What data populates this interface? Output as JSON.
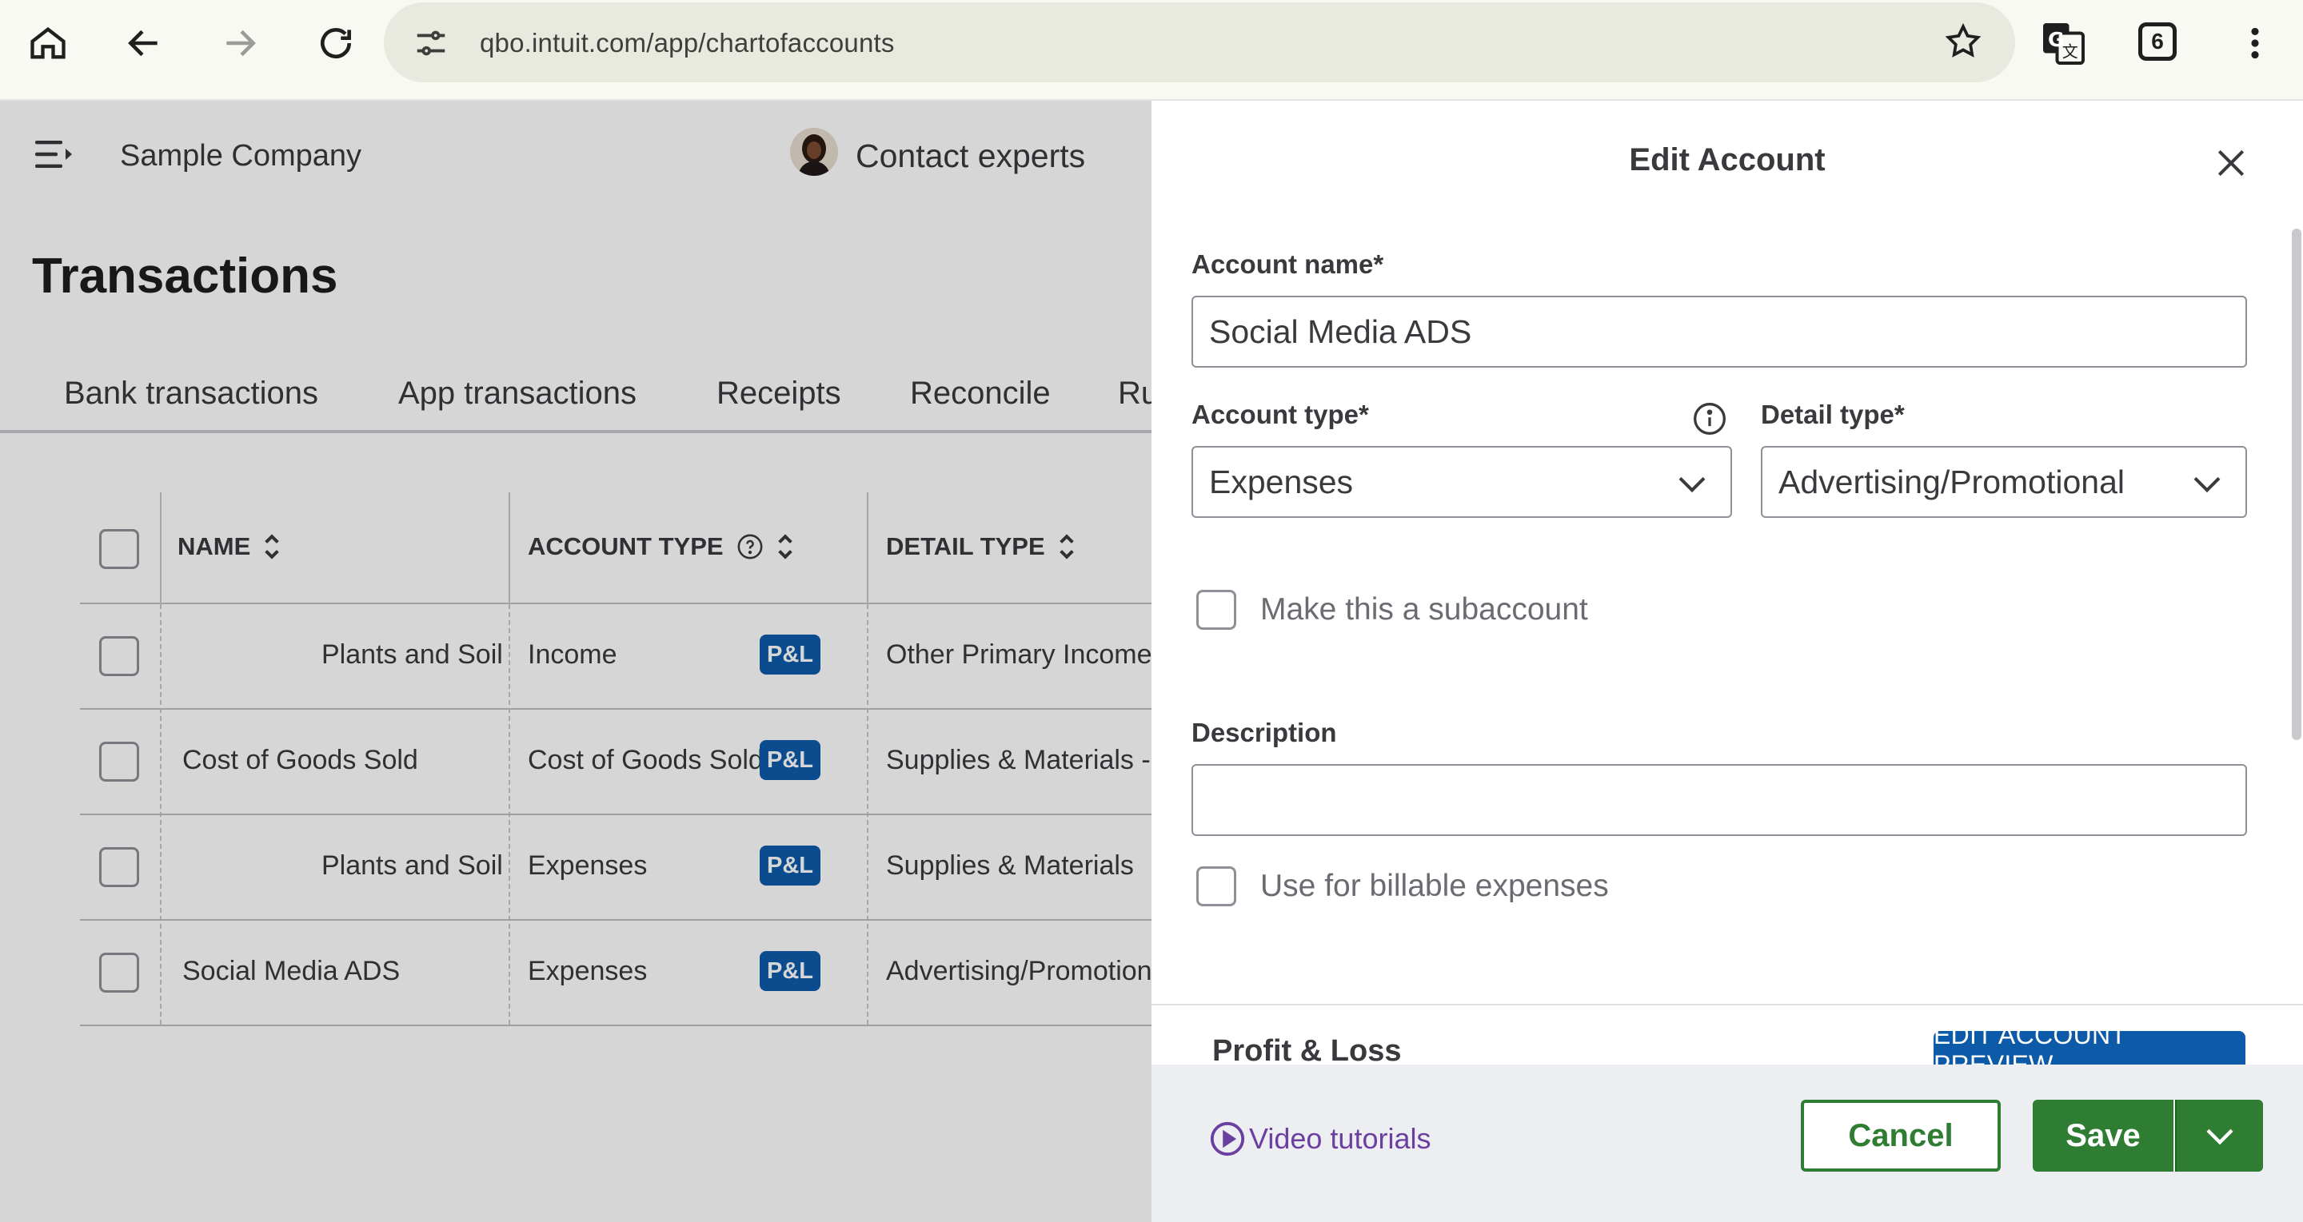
{
  "browser": {
    "url": "qbo.intuit.com/app/chartofaccounts",
    "tab_count": "6",
    "icons": [
      "home-icon",
      "back-icon",
      "forward-icon",
      "reload-icon",
      "site-settings-icon",
      "bookmark-star-icon",
      "translate-icon",
      "menu-dots-icon"
    ]
  },
  "app": {
    "company_name": "Sample Company",
    "contact_label": "Contact experts",
    "page_title": "Transactions",
    "tabs": [
      {
        "label": "Bank transactions"
      },
      {
        "label": "App transactions"
      },
      {
        "label": "Receipts"
      },
      {
        "label": "Reconcile"
      },
      {
        "label": "Ru"
      }
    ],
    "table": {
      "columns": [
        {
          "label": "NAME"
        },
        {
          "label": "ACCOUNT TYPE"
        },
        {
          "label": "DETAIL TYPE"
        }
      ],
      "rows": [
        {
          "name": "Plants and Soil",
          "account_type": "Income",
          "badge": "P&L",
          "detail_type": "Other Primary Income",
          "indented": true
        },
        {
          "name": "Cost of Goods Sold",
          "account_type": "Cost of Goods Sold",
          "badge": "P&L",
          "detail_type": "Supplies & Materials - C",
          "indented": false
        },
        {
          "name": "Plants and Soil",
          "account_type": "Expenses",
          "badge": "P&L",
          "detail_type": "Supplies & Materials",
          "indented": true
        },
        {
          "name": "Social Media ADS",
          "account_type": "Expenses",
          "badge": "P&L",
          "detail_type": "Advertising/Promotion",
          "indented": false
        }
      ]
    }
  },
  "panel": {
    "title": "Edit Account",
    "account_name_label": "Account name*",
    "account_name_value": "Social Media ADS",
    "account_type_label": "Account type*",
    "account_type_value": "Expenses",
    "detail_type_label": "Detail type*",
    "detail_type_value": "Advertising/Promotional",
    "subaccount_label": "Make this a subaccount",
    "description_label": "Description",
    "description_value": "",
    "billable_label": "Use for billable expenses",
    "pl_section_title": "Profit & Loss",
    "preview_badge": "EDIT ACCOUNT PREVIEW",
    "video_tutorials": "Video tutorials",
    "cancel_label": "Cancel",
    "save_label": "Save"
  },
  "colors": {
    "brand_green": "#2e7d32",
    "badge_blue": "#0d5ba8",
    "link_purple": "#6b3fa0"
  }
}
